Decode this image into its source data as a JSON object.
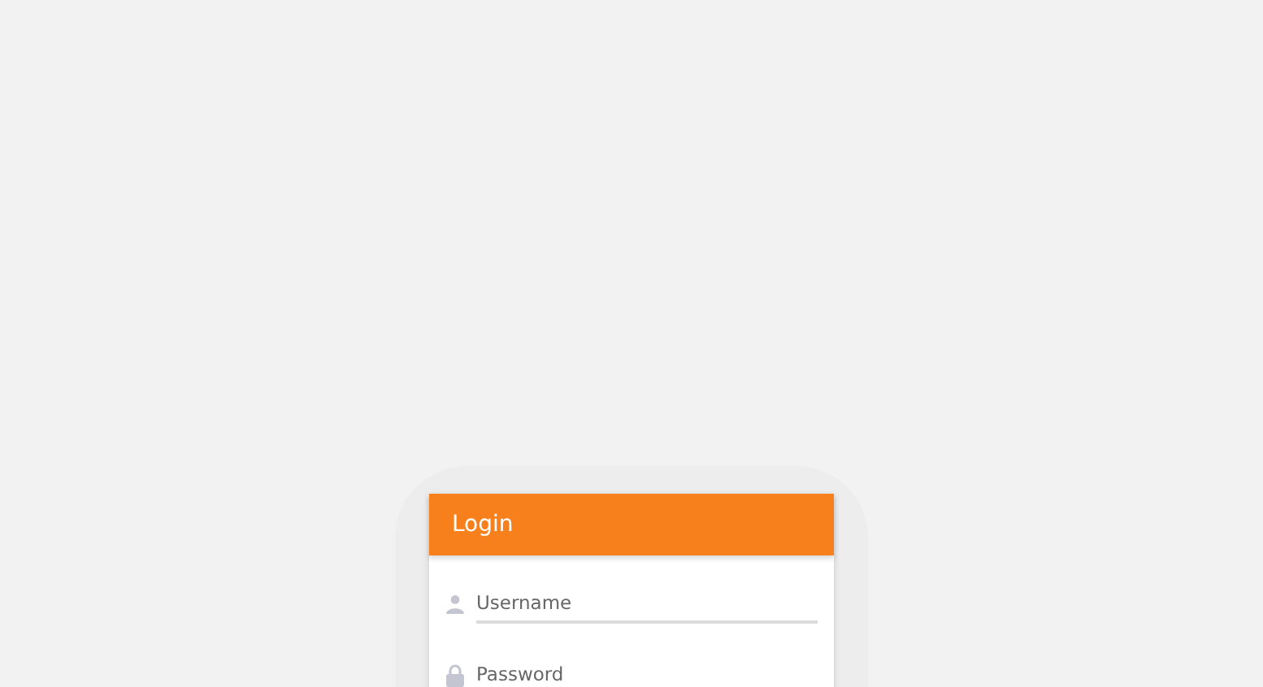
{
  "login_card": {
    "title": "Login",
    "fields": [
      {
        "kind": "username",
        "placeholder": "Username"
      },
      {
        "kind": "password",
        "placeholder": "Password"
      }
    ]
  }
}
